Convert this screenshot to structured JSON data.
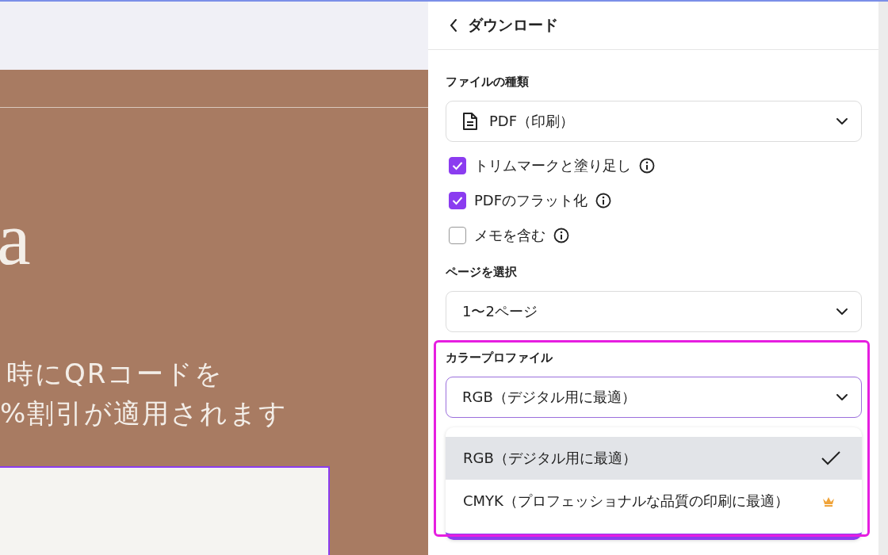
{
  "canvas": {
    "heading": "a",
    "lines": [
      "時にQRコードを",
      "%割引が適用されます"
    ]
  },
  "panel": {
    "title": "ダウンロード",
    "file_type": {
      "label": "ファイルの種類",
      "value": "PDF（印刷）"
    },
    "options": [
      {
        "label": "トリムマークと塗り足し",
        "checked": true
      },
      {
        "label": "PDFのフラット化",
        "checked": true
      },
      {
        "label": "メモを含む",
        "checked": false
      }
    ],
    "pages": {
      "label": "ページを選択",
      "value": "1〜2ページ"
    },
    "color_profile": {
      "label": "カラープロファイル",
      "value": "RGB（デジタル用に最適）",
      "expanded": true,
      "menu": [
        {
          "label": "RGB（デジタル用に最適）",
          "selected": true,
          "premium": false
        },
        {
          "label": "CMYK（プロフェッショナルな品質の印刷に最適）",
          "selected": false,
          "premium": true
        }
      ]
    }
  }
}
